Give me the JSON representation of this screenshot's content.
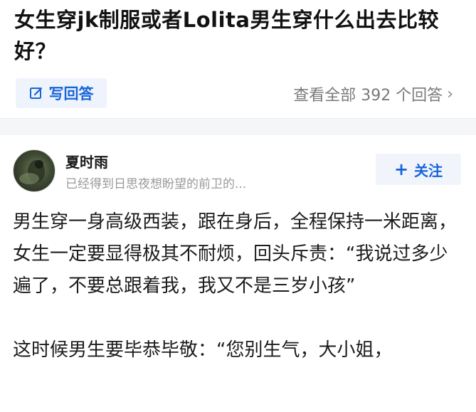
{
  "question": {
    "title": "女生穿jk制服或者Lolita男生穿什么出去比较好？",
    "write_answer_label": "写回答",
    "view_all_label": "查看全部 392 个回答",
    "chevron": "›"
  },
  "answer": {
    "author_name": "夏时雨",
    "author_bio": "已经得到日思夜想盼望的前卫的...",
    "follow_label": "关注",
    "follow_plus": "+",
    "paragraphs": [
      "男生穿一身高级西装，跟在身后，全程保持一米距离，女生一定要显得极其不耐烦，回头斥责：“我说过多少遍了，不要总跟着我，我又不是三岁小孩”",
      "这时候男生要毕恭毕敬：“您别生气，大小姐，"
    ]
  },
  "colors": {
    "accent_blue": "#1765d8",
    "button_bg": "#eef3fc",
    "muted_text": "#7a7a7a",
    "divider_bg": "#f5f6f7"
  },
  "icons": {
    "write_answer": "edit-square-icon",
    "view_all": "chevron-right-icon",
    "follow": "plus-icon"
  }
}
